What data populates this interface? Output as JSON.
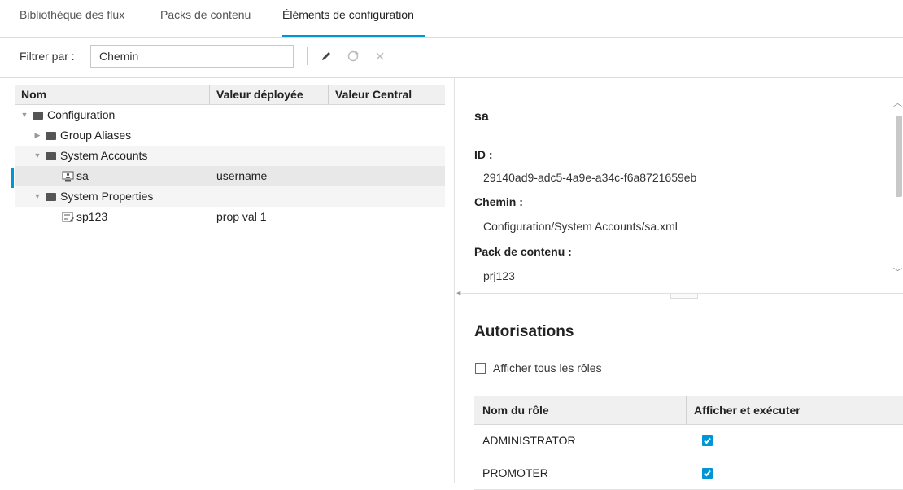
{
  "tabs": [
    {
      "label": "Bibliothèque des flux"
    },
    {
      "label": "Packs de contenu"
    },
    {
      "label": "Éléments de configuration"
    }
  ],
  "filter": {
    "label": "Filtrer par :",
    "value": "Chemin"
  },
  "grid": {
    "headers": [
      "Nom",
      "Valeur déployée",
      "Valeur Central"
    ],
    "rows": [
      {
        "name": "Configuration",
        "value": ""
      },
      {
        "name": "Group Aliases",
        "value": ""
      },
      {
        "name": "System Accounts",
        "value": ""
      },
      {
        "name": "sa",
        "value": "username"
      },
      {
        "name": "System Properties",
        "value": ""
      },
      {
        "name": "sp123",
        "value": "prop val 1"
      }
    ]
  },
  "details": {
    "title": "sa",
    "id_label": "ID :",
    "id_value": "29140ad9-adc5-4a9e-a34c-f6a8721659eb",
    "path_label": "Chemin :",
    "path_value": "Configuration/System Accounts/sa.xml",
    "pack_label": "Pack de contenu :",
    "pack_value": "prj123"
  },
  "permissions": {
    "title": "Autorisations",
    "show_all_label": "Afficher tous les rôles",
    "show_all_checked": false,
    "headers": [
      "Nom du rôle",
      "Afficher et exécuter"
    ],
    "roles": [
      {
        "name": "ADMINISTRATOR",
        "checked": true
      },
      {
        "name": "PROMOTER",
        "checked": true
      }
    ]
  },
  "colors": {
    "accent": "#0096d6",
    "header_bg": "#f0f0f0",
    "selected_row": "#e8e8e8"
  }
}
